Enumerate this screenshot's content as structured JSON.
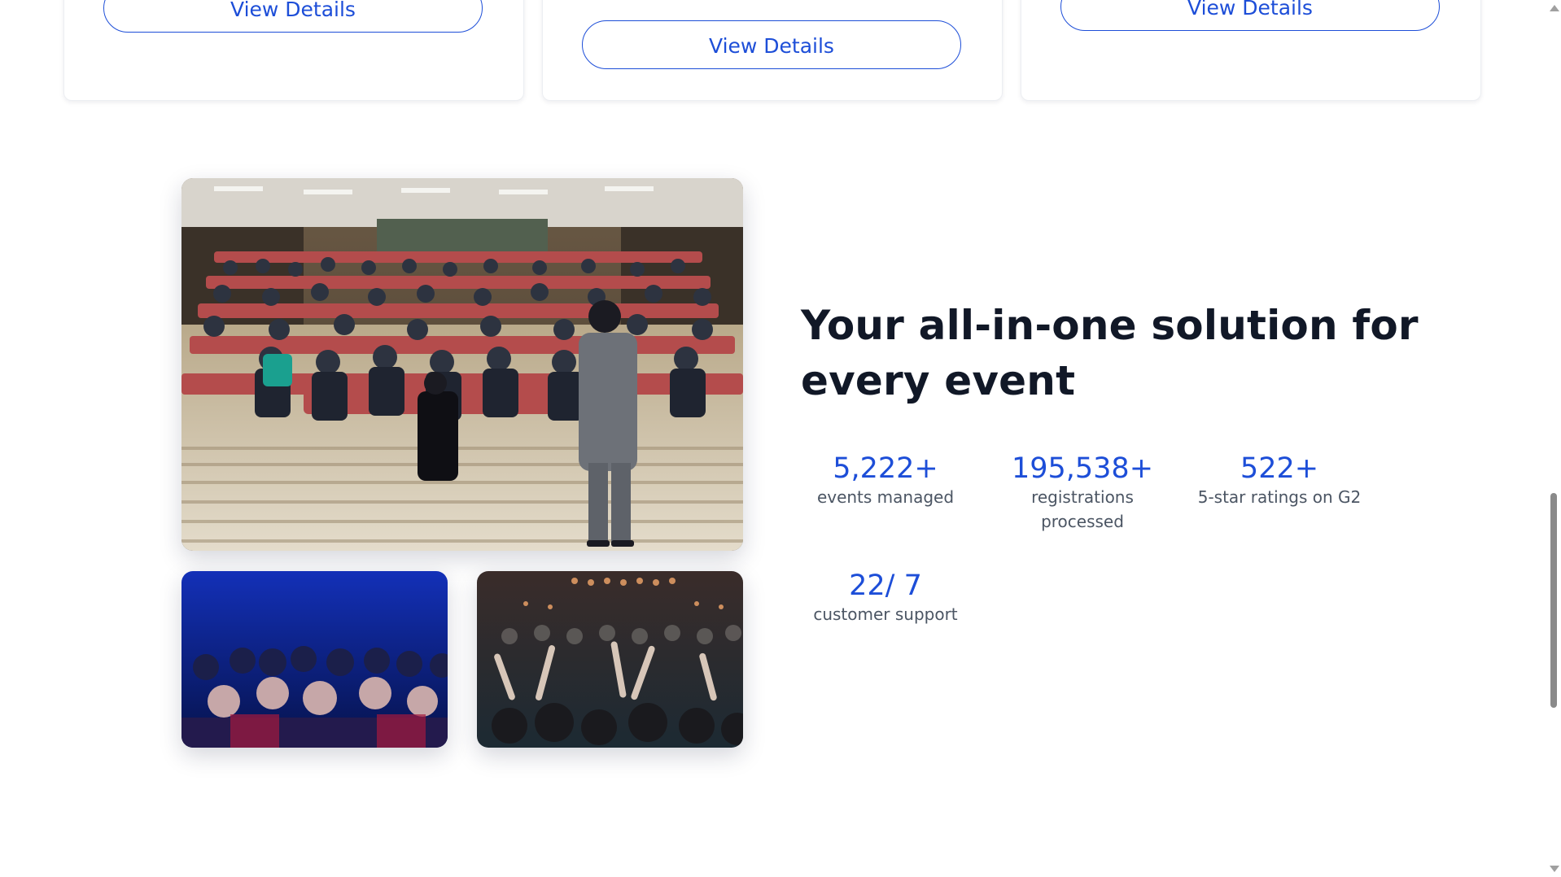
{
  "cards": [
    {
      "button_label": "View Details"
    },
    {
      "button_label": "View Details"
    },
    {
      "button_label": "View Details"
    }
  ],
  "feature": {
    "headline": "Your all-in-one solution for every event",
    "stats": [
      {
        "number": "5,222+",
        "label": "events managed"
      },
      {
        "number": "195,538+",
        "label": "registrations processed"
      },
      {
        "number": "522+",
        "label": "5-star ratings on G2"
      },
      {
        "number": "22/ 7",
        "label": "customer support"
      }
    ]
  },
  "colors": {
    "accent": "#1d4ed8",
    "heading": "#111827",
    "body_text": "#4b5563"
  },
  "images": {
    "main": "conference-lecture-hall-photo",
    "small1": "audience-blue-light-photo",
    "small2": "concert-crowd-photo"
  }
}
